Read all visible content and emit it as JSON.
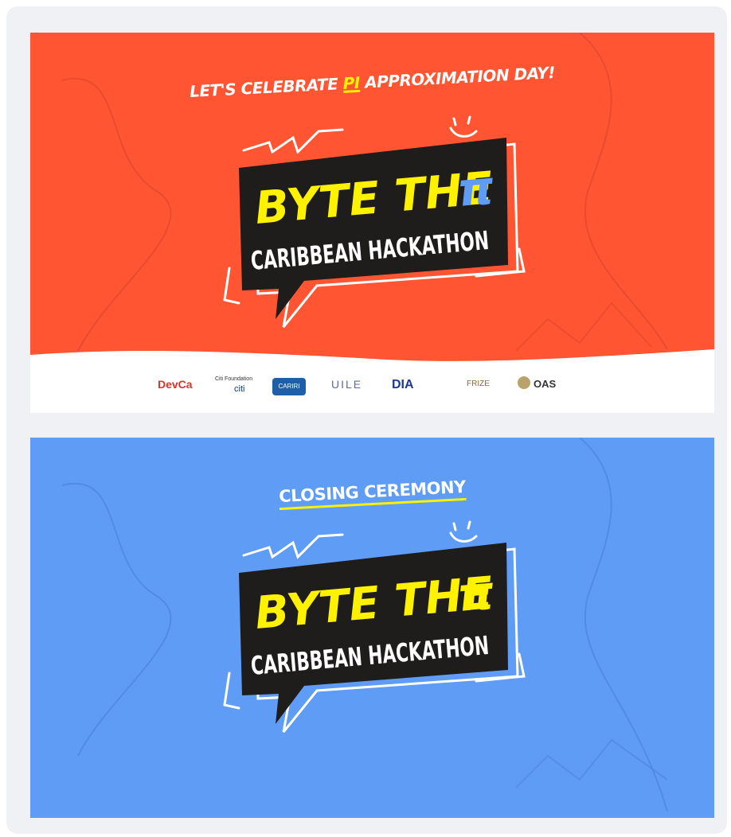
{
  "banner1": {
    "tagline_pre": "LET'S CELEBRATE ",
    "tagline_hl": "PI",
    "tagline_post": " APPROXIMATION DAY!",
    "logo_line1": "BYTE THE",
    "logo_pi": "π",
    "logo_line2": "CARIBBEAN HACKATHON",
    "sponsors": [
      "DevCa",
      "Citi Foundation",
      "citi",
      "CARIRI",
      "UILE",
      "DIA",
      "FRIZE",
      "OAS"
    ],
    "colors": {
      "background": "#ff5533",
      "pi": "#5f9cf5"
    }
  },
  "banner2": {
    "tagline": "CLOSING CEREMONY",
    "logo_line1": "BYTE THE",
    "logo_pi": "π",
    "logo_line2": "CARIBBEAN HACKATHON",
    "colors": {
      "background": "#5f9cf5",
      "pi": "#fff200"
    }
  }
}
